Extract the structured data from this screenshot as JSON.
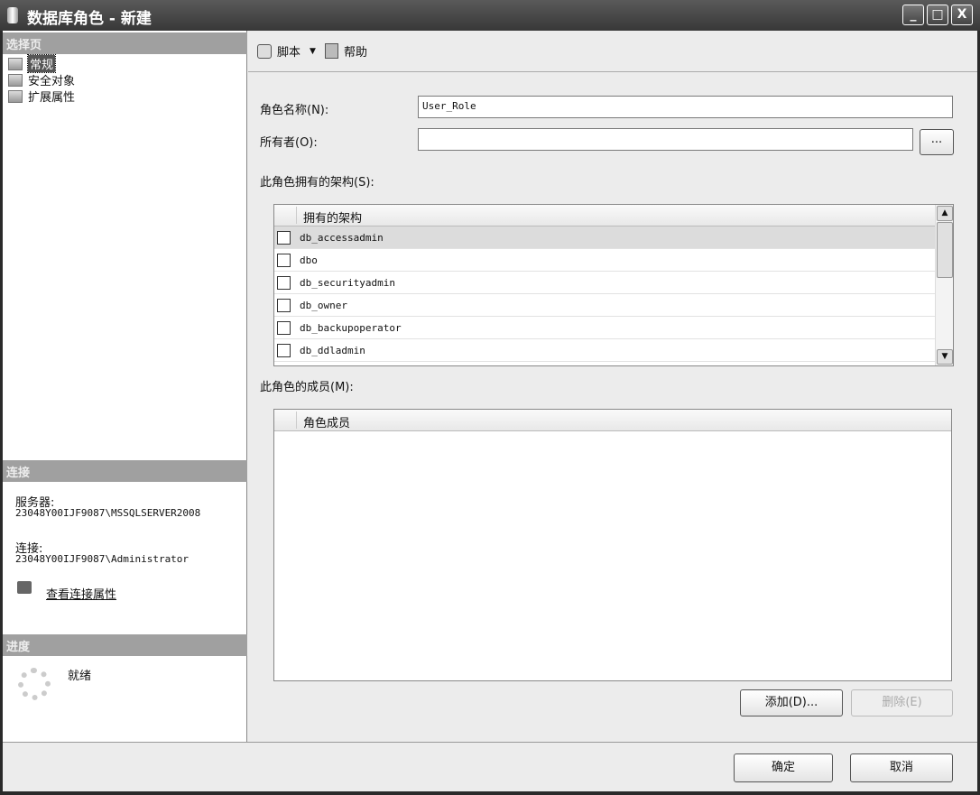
{
  "window": {
    "title": "数据库角色 - 新建",
    "controls": [
      "_",
      "□",
      "X"
    ]
  },
  "sidebar": {
    "select_page_header": "选择页",
    "pages": [
      {
        "label": "常规",
        "selected": true
      },
      {
        "label": "安全对象"
      },
      {
        "label": "扩展属性"
      }
    ],
    "connection_header": "连接",
    "server_label": "服务器:",
    "server_value": "23048Y00IJF9087\\MSSQLSERVER2008",
    "connection_label": "连接:",
    "connection_value": "23048Y00IJF9087\\Administrator",
    "view_connection_link": "查看连接属性",
    "progress_header": "进度",
    "progress_status": "就绪"
  },
  "toolbar": {
    "script_label": "脚本",
    "help_label": "帮助"
  },
  "form": {
    "role_name_label": "角色名称(N):",
    "role_name_value": "User_Role",
    "owner_label": "所有者(O):",
    "owner_value": "",
    "browse_label": "...",
    "schemas_label": "此角色拥有的架构(S):",
    "schemas_header": "拥有的架构",
    "schemas": [
      {
        "name": "db_accessadmin",
        "checked": false
      },
      {
        "name": "dbo",
        "checked": false
      },
      {
        "name": "db_securityadmin",
        "checked": false
      },
      {
        "name": "db_owner",
        "checked": false
      },
      {
        "name": "db_backupoperator",
        "checked": false
      },
      {
        "name": "db_ddladmin",
        "checked": false
      }
    ],
    "members_label": "此角色的成员(M):",
    "members_header": "角色成员",
    "add_label": "添加(D)...",
    "remove_label": "删除(E)"
  },
  "footer": {
    "ok_label": "确定",
    "cancel_label": "取消"
  }
}
